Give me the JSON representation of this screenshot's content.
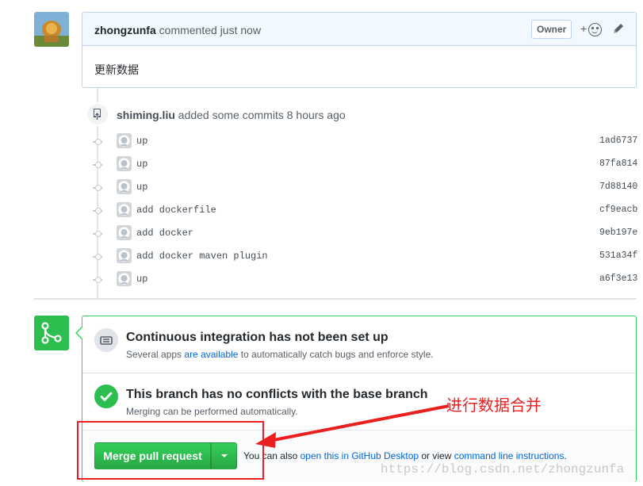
{
  "comment": {
    "author": "zhongzunfa",
    "action": "commented just now",
    "owner_badge": "Owner",
    "reaction_plus": "+",
    "body": "更新数据"
  },
  "event": {
    "actor": "shiming.liu",
    "action": "added some commits 8 hours ago"
  },
  "commits": [
    {
      "message": "up",
      "sha": "1ad6737"
    },
    {
      "message": "up",
      "sha": "87fa814"
    },
    {
      "message": "up",
      "sha": "7d88140"
    },
    {
      "message": "add dockerfile",
      "sha": "cf9eacb"
    },
    {
      "message": "add docker",
      "sha": "9eb197e"
    },
    {
      "message": "add docker maven plugin",
      "sha": "531a34f"
    },
    {
      "message": "up",
      "sha": "a6f3e13"
    }
  ],
  "merge": {
    "ci_title": "Continuous integration has not been set up",
    "ci_sub_prefix": "Several apps ",
    "ci_sub_link": "are available",
    "ci_sub_suffix": " to automatically catch bugs and enforce style.",
    "branch_title": "This branch has no conflicts with the base branch",
    "branch_sub": "Merging can be performed automatically.",
    "merge_button": "Merge pull request",
    "alt_prefix": "You can also ",
    "alt_link1": "open this in GitHub Desktop",
    "alt_mid": " or view ",
    "alt_link2": "command line instructions",
    "alt_suffix": "."
  },
  "annotation": {
    "text": "进行数据合并",
    "color": "#ea1f1f"
  },
  "watermark": "https://blog.csdn.net/zhongzunfa",
  "colors": {
    "green": "#2cbe4e",
    "link": "#0366d6",
    "header_bg": "#f1f8ff"
  }
}
